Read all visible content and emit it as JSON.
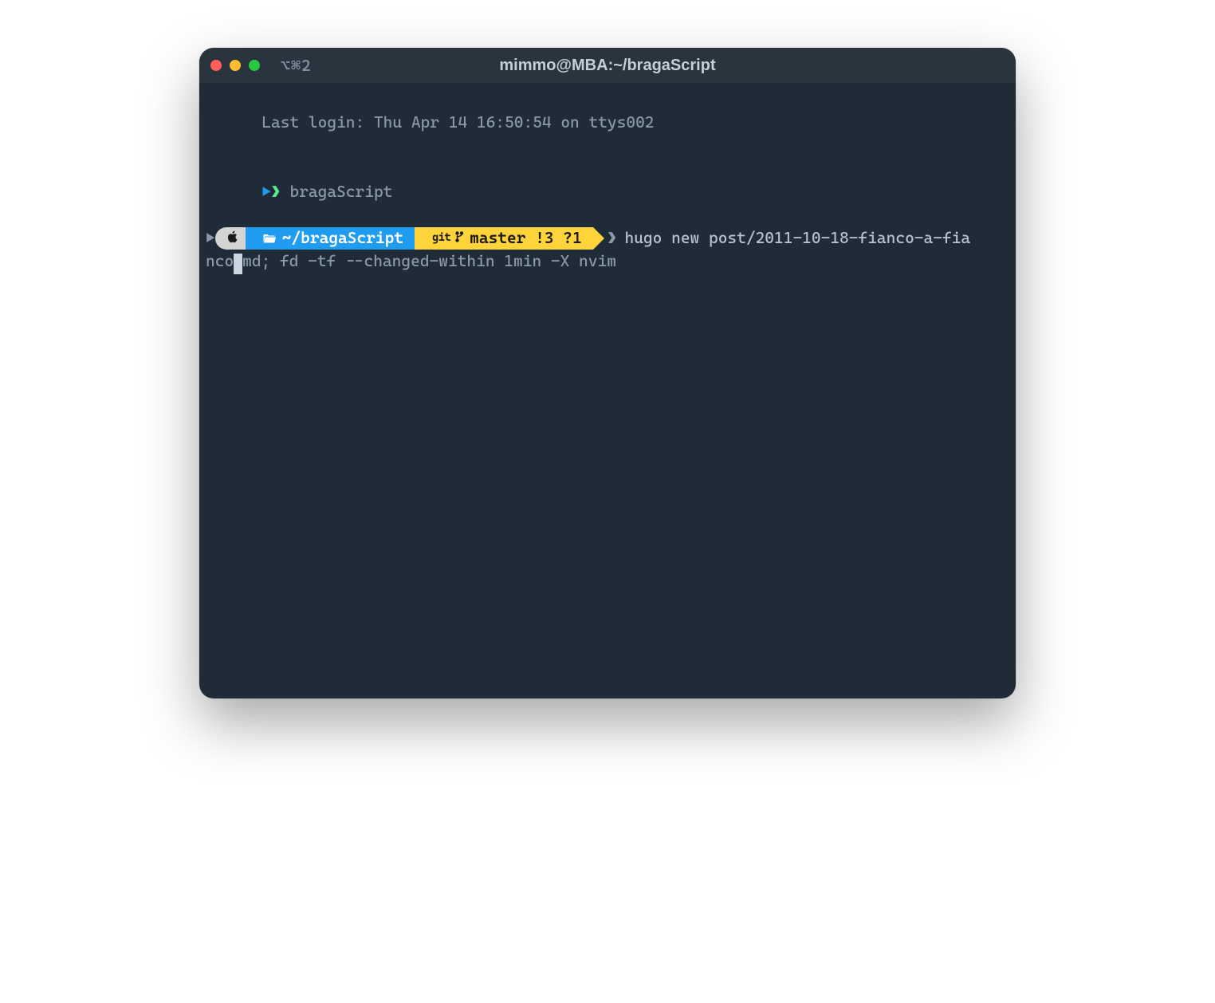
{
  "titlebar": {
    "tab_hint": "⌥⌘2",
    "title": "mimmo@MBA:~/bragaScript"
  },
  "terminal": {
    "last_login": "Last login: Thu Apr 14 16:50:54 on ttys002",
    "prev_cmd": "bragaScript",
    "prompt": {
      "os_icon": "apple-icon",
      "path": "~/bragaScript",
      "git_branch": "master",
      "git_status": "!3 ?1"
    },
    "command_line1": "hugo new post/2011-10-18-fianco-a-fia",
    "command_line2_pre": "nco",
    "command_line2_post": "md; fd -tf --changed-within 1min -X nvim"
  },
  "colors": {
    "window_bg": "#1f2c38",
    "titlebar_bg": "#29343f",
    "path_bg": "#1f9cf0",
    "git_bg": "#ffd43b",
    "os_bg": "#d4d4d4"
  }
}
